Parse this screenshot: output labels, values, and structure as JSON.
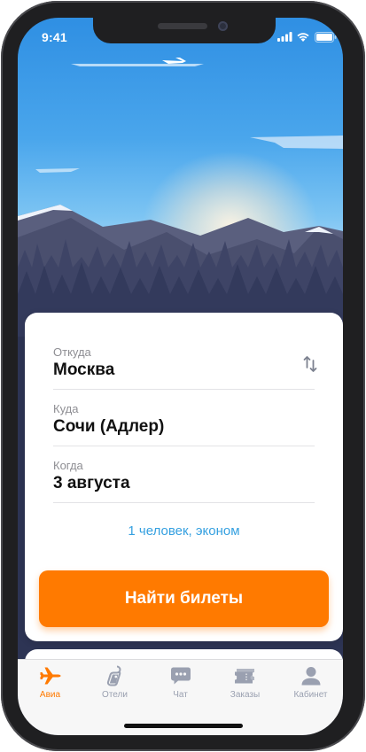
{
  "status_bar": {
    "time": "9:41"
  },
  "search_form": {
    "from": {
      "label": "Откуда",
      "value": "Москва"
    },
    "to": {
      "label": "Куда",
      "value": "Сочи (Адлер)"
    },
    "date": {
      "label": "Когда",
      "value": "3 августа"
    },
    "passengers": "1 человек, эконом",
    "search_button": "Найти билеты"
  },
  "tab_bar": {
    "active_index": 0,
    "items": [
      {
        "label": "Авиа",
        "icon": "airplane-icon"
      },
      {
        "label": "Отели",
        "icon": "hotel-tag-icon"
      },
      {
        "label": "Чат",
        "icon": "chat-icon"
      },
      {
        "label": "Заказы",
        "icon": "tickets-icon"
      },
      {
        "label": "Кабинет",
        "icon": "profile-icon"
      }
    ]
  },
  "colors": {
    "accent": "#ff7a00",
    "link": "#35a0e0",
    "tab_inactive": "#9aa0b0"
  }
}
